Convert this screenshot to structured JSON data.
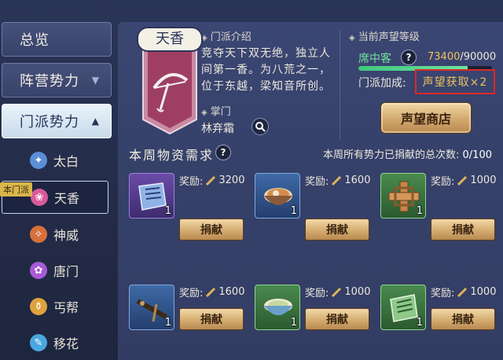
{
  "sidebar": {
    "tabs": [
      {
        "label": "总览",
        "chevron": ""
      },
      {
        "label": "阵营势力",
        "chevron": "▼"
      },
      {
        "label": "门派势力",
        "chevron": "▲"
      }
    ],
    "own_tag": "本门派",
    "sects": [
      {
        "label": "太白",
        "icon": "taibai-icon",
        "color": "#5a8fd6",
        "glyph": "✦"
      },
      {
        "label": "天香",
        "icon": "tianxiang-icon",
        "color": "#d85a9a",
        "glyph": "❀"
      },
      {
        "label": "神威",
        "icon": "shenwei-icon",
        "color": "#d6703c",
        "glyph": "✧"
      },
      {
        "label": "唐门",
        "icon": "tangmen-icon",
        "color": "#a85ad6",
        "glyph": "✿"
      },
      {
        "label": "丐帮",
        "icon": "gaibang-icon",
        "color": "#e0a23c",
        "glyph": "⚱"
      },
      {
        "label": "移花",
        "icon": "yihua-icon",
        "color": "#4aa8e0",
        "glyph": "✎"
      }
    ]
  },
  "sect_info": {
    "name": "天香",
    "intro_heading": "门派介绍",
    "intro_text": "竞夺天下双无绝，独立人间第一香。为八荒之一，位于东越，梁知音所创。",
    "leader_heading": "掌门",
    "leader_name": "林弃霜"
  },
  "reputation": {
    "heading": "当前声望等级",
    "title": "席中客",
    "current": "73400",
    "max": "/90000",
    "progress": 0.8156,
    "bonus_label": "门派加成:",
    "bonus_value": "声望获取×2",
    "shop_label": "声望商店"
  },
  "weekly": {
    "heading": "本周物资需求",
    "total_label": "本周所有势力已捐献的总次数:",
    "total_count": "0/100"
  },
  "items": [
    {
      "name": "purple-scroll-item",
      "rarity": "purple",
      "qty": "1",
      "reward_label": "奖励:",
      "reward": "3200",
      "button": "捐献"
    },
    {
      "name": "noodle-bowl-item",
      "rarity": "blue",
      "qty": "1",
      "reward_label": "奖励:",
      "reward": "1600",
      "button": "捐献"
    },
    {
      "name": "wooden-puzzle-item",
      "rarity": "green",
      "qty": "1",
      "reward_label": "奖励:",
      "reward": "1000",
      "button": "捐献"
    },
    {
      "name": "crossbow-item",
      "rarity": "blue",
      "qty": "1",
      "reward_label": "奖励:",
      "reward": "1600",
      "button": "捐献"
    },
    {
      "name": "soup-bowl-item",
      "rarity": "green",
      "qty": "1",
      "reward_label": "奖励:",
      "reward": "1000",
      "button": "捐献"
    },
    {
      "name": "green-scroll-item",
      "rarity": "green",
      "qty": "1",
      "reward_label": "奖励:",
      "reward": "1000",
      "button": "捐献"
    }
  ]
}
